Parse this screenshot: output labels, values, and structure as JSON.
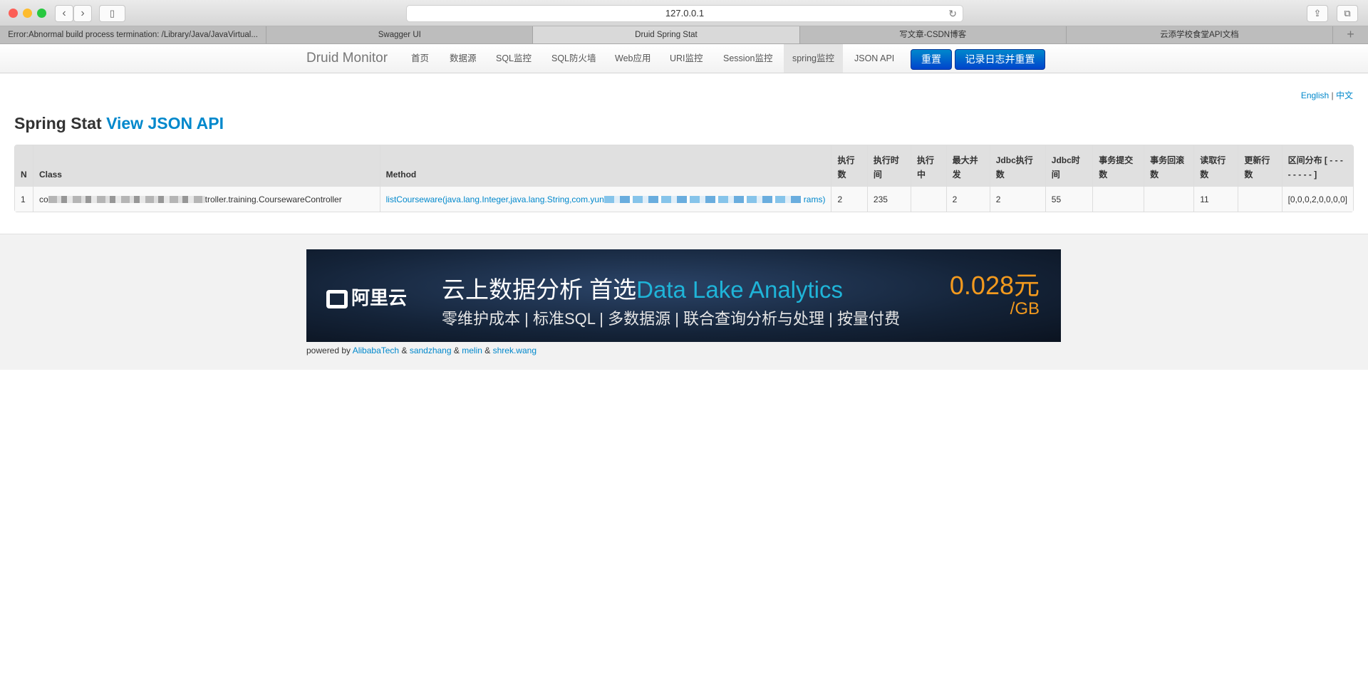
{
  "browser": {
    "url": "127.0.0.1",
    "tabs": [
      {
        "label": "Error:Abnormal build process termination: /Library/Java/JavaVirtual..."
      },
      {
        "label": "Swagger UI"
      },
      {
        "label": "Druid Spring Stat",
        "active": true
      },
      {
        "label": "写文章-CSDN博客"
      },
      {
        "label": "云添学校食堂API文档"
      }
    ],
    "new_tab": "+"
  },
  "nav": {
    "brand": "Druid Monitor",
    "items": [
      "首页",
      "数据源",
      "SQL监控",
      "SQL防火墙",
      "Web应用",
      "URI监控",
      "Session监控",
      "spring监控",
      "JSON API"
    ],
    "active": "spring监控",
    "reset_label": "重置",
    "log_reset_label": "记录日志并重置",
    "accent": "#0055cc"
  },
  "lang": {
    "english": "English",
    "sep": "|",
    "chinese": "中文"
  },
  "page": {
    "title": "Spring Stat",
    "json_link": "View JSON API"
  },
  "table": {
    "headers": [
      "N",
      "Class",
      "Method",
      "执行数",
      "执行时间",
      "执行中",
      "最大并发",
      "Jdbc执行数",
      "Jdbc时间",
      "事务提交数",
      "事务回滚数",
      "读取行数",
      "更新行数",
      "区间分布 [ - - - - - - - - ]"
    ],
    "rows": [
      {
        "n": "1",
        "class_prefix": "co",
        "class_suffix": "troller.training.CoursewareController",
        "method_prefix": "listCourseware(java.lang.Integer,java.lang.String,com.yun",
        "method_suffix": "rams)",
        "exec_count": "2",
        "exec_time": "235",
        "running": "",
        "max_concurrent": "2",
        "jdbc_exec_count": "2",
        "jdbc_time": "55",
        "tx_commit": "",
        "tx_rollback": "",
        "fetch_rows": "11",
        "update_rows": "",
        "histogram": "[0,0,0,2,0,0,0,0]"
      }
    ]
  },
  "banner": {
    "logo": "阿里云",
    "headline": "云上数据分析 首选",
    "headline_highlight": "Data Lake Analytics",
    "subline": "零维护成本 | 标准SQL | 多数据源 | 联合查询分析与处理 | 按量付费",
    "price": "0.028元",
    "unit": "/GB"
  },
  "footer": {
    "powered_by": "powered by",
    "links": [
      "AlibabaTech",
      "sandzhang",
      "melin",
      "shrek.wang"
    ],
    "amp": "&"
  }
}
